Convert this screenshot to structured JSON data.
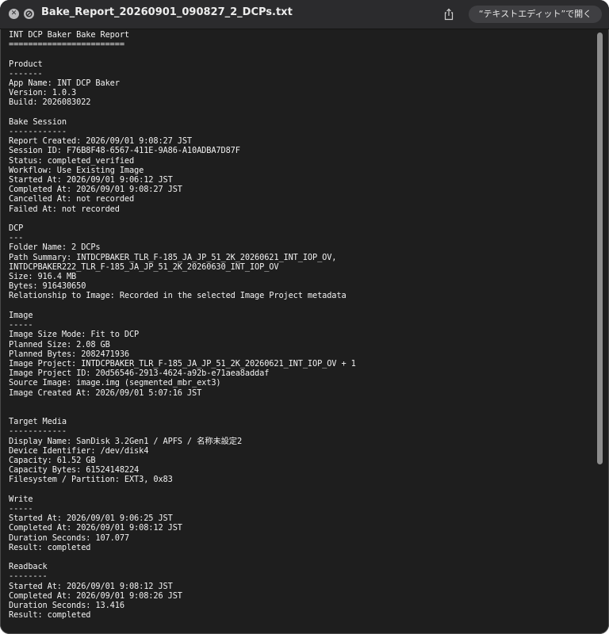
{
  "window": {
    "title": "Bake_Report_20260901_090827_2_DCPs.txt",
    "open_with_label": "“テキストエディット”で開く",
    "icons": {
      "close": "close-x-icon",
      "block": "block-icon",
      "share": "share-icon"
    },
    "colors": {
      "background": "#1e1e1e",
      "titlebar": "#2b2b2d",
      "text": "#f2f2f2"
    }
  },
  "document": {
    "text": "INT DCP Baker Bake Report\n========================\n\nProduct\n-------\nApp Name: INT DCP Baker\nVersion: 1.0.3\nBuild: 2026083022\n\nBake Session\n------------\nReport Created: 2026/09/01 9:08:27 JST\nSession ID: F76B8F48-6567-411E-9A86-A10ADBA7D87F\nStatus: completed_verified\nWorkflow: Use Existing Image\nStarted At: 2026/09/01 9:06:12 JST\nCompleted At: 2026/09/01 9:08:27 JST\nCancelled At: not recorded\nFailed At: not recorded\n\nDCP\n---\nFolder Name: 2 DCPs\nPath Summary: INTDCPBAKER_TLR_F-185_JA_JP_51_2K_20260621_INT_IOP_OV,\nINTDCPBAKER222_TLR_F-185_JA_JP_51_2K_20260630_INT_IOP_OV\nSize: 916.4 MB\nBytes: 916430650\nRelationship to Image: Recorded in the selected Image Project metadata\n\nImage\n-----\nImage Size Mode: Fit to DCP\nPlanned Size: 2.08 GB\nPlanned Bytes: 2082471936\nImage Project: INTDCPBAKER_TLR_F-185_JA_JP_51_2K_20260621_INT_IOP_OV + 1\nImage Project ID: 20d56546-2913-4624-a92b-e71aea8addaf\nSource Image: image.img (segmented_mbr_ext3)\nImage Created At: 2026/09/01 5:07:16 JST\n\n\nTarget Media\n------------\nDisplay Name: SanDisk 3.2Gen1 / APFS / 名称未設定2\nDevice Identifier: /dev/disk4\nCapacity: 61.52 GB\nCapacity Bytes: 61524148224\nFilesystem / Partition: EXT3, 0x83\n\nWrite\n-----\nStarted At: 2026/09/01 9:06:25 JST\nCompleted At: 2026/09/01 9:08:12 JST\nDuration Seconds: 107.077\nResult: completed\n\nReadback\n--------\nStarted At: 2026/09/01 9:08:12 JST\nCompleted At: 2026/09/01 9:08:26 JST\nDuration Seconds: 13.416\nResult: completed"
  }
}
